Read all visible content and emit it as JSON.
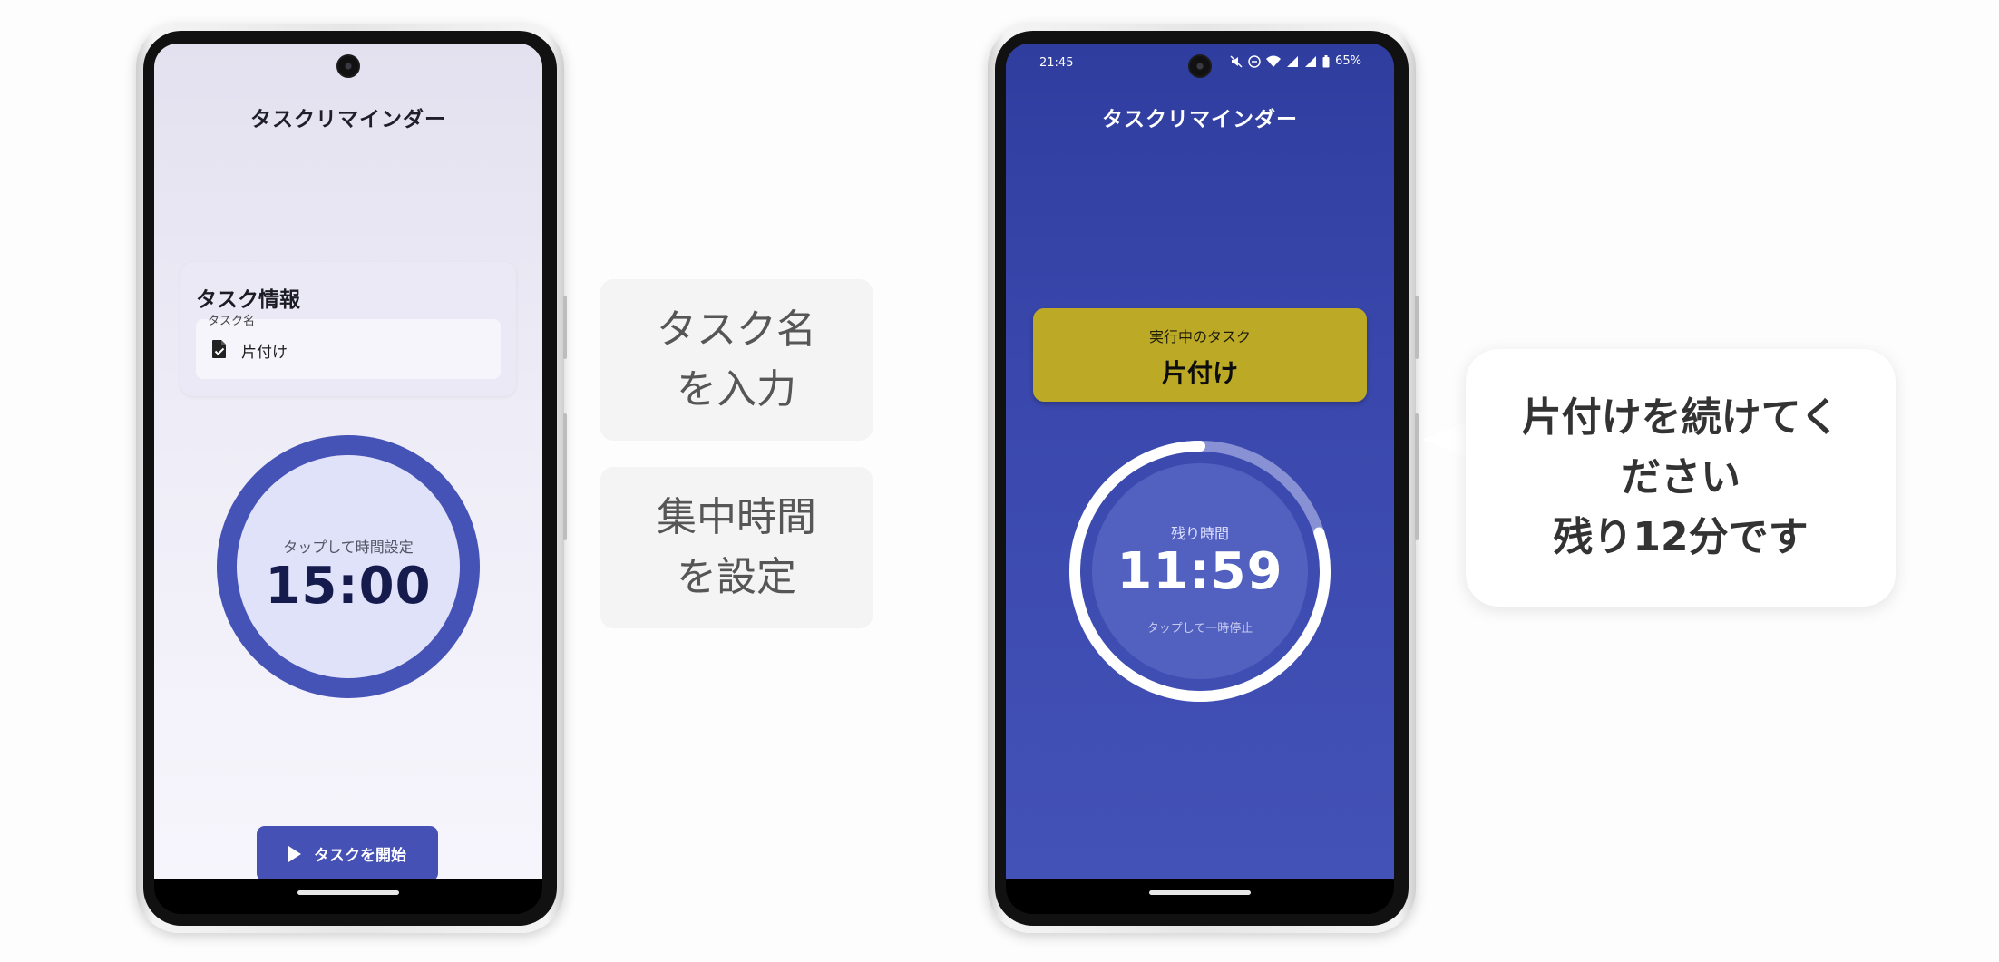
{
  "left_phone": {
    "app_title": "タスクリマインダー",
    "task_card": {
      "title": "タスク情報",
      "field_label": "タスク名",
      "field_icon": "task-file-icon",
      "field_value": "片付け"
    },
    "timer": {
      "caption": "タップして時間設定",
      "time": "15:00"
    },
    "start_button": {
      "icon": "play-icon",
      "label": "タスクを開始"
    }
  },
  "captions": {
    "step1_line1": "タスク名",
    "step1_line2": "を入力",
    "step2_line1": "集中時間",
    "step2_line2": "を設定"
  },
  "right_phone": {
    "status_bar": {
      "time": "21:45",
      "battery": "65%"
    },
    "app_title": "タスクリマインダー",
    "running_card": {
      "label": "実行中のタスク",
      "task_name": "片付け"
    },
    "timer": {
      "caption": "残り時間",
      "time": "11:59",
      "hint": "タップして一時停止",
      "progress_fraction_elapsed": 0.2
    }
  },
  "bubble": {
    "line1": "片付けを続けてく",
    "line2": "ださい",
    "line3": "残り12分です"
  },
  "colors": {
    "primary": "#4551b4",
    "running_card": "#bcaa26",
    "right_background": "#3a48ad"
  }
}
